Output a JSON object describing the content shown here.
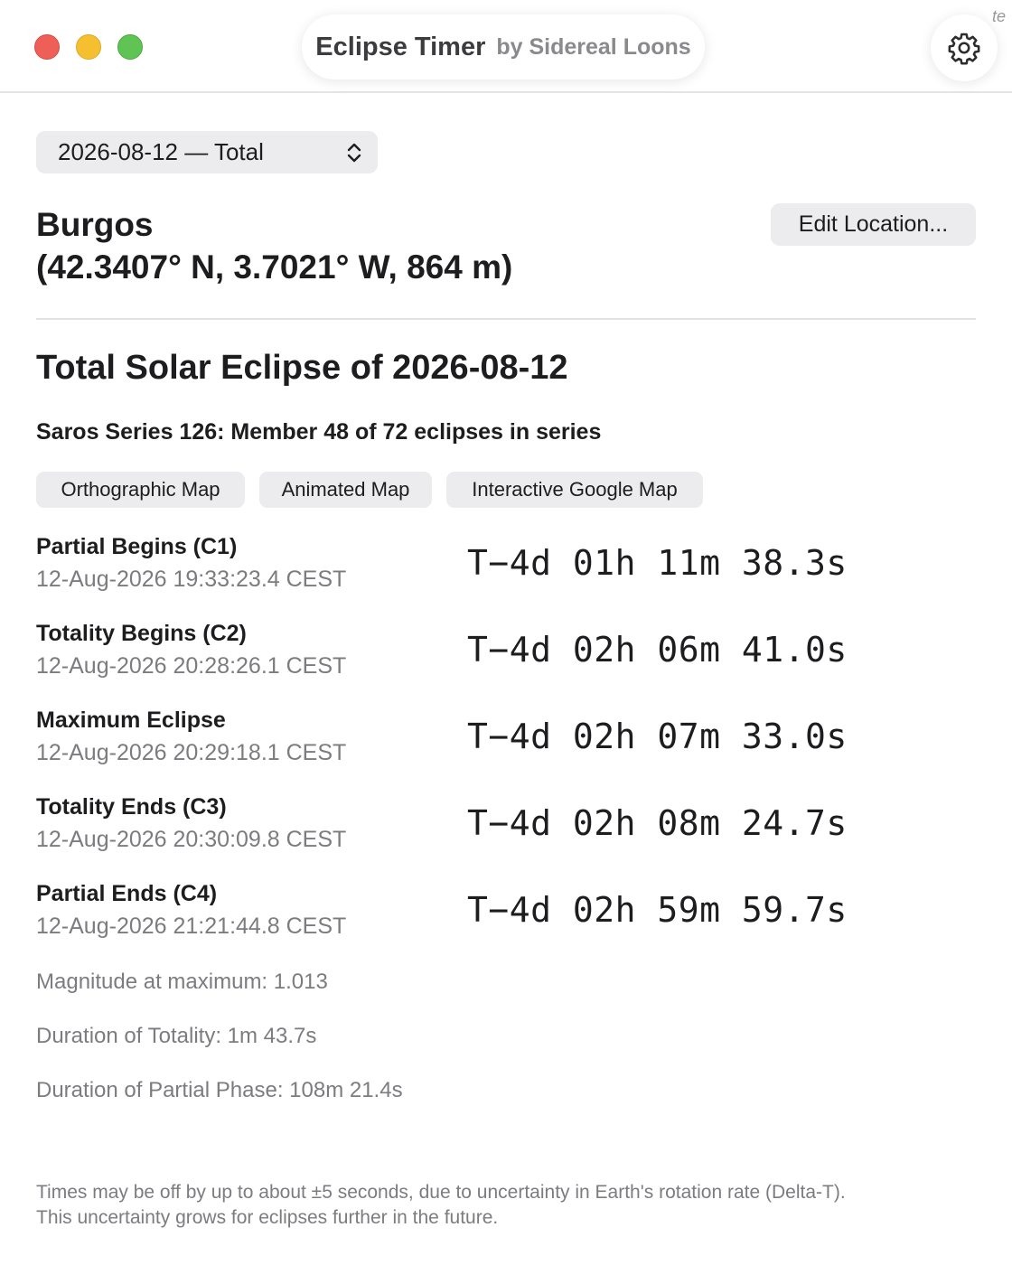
{
  "window": {
    "title": "Eclipse Timer",
    "subtitle": "by Sidereal Loons",
    "corner_fragment": "te"
  },
  "eclipse_selector": {
    "selected": "2026-08-12 — Total"
  },
  "location": {
    "name": "Burgos",
    "coords": "(42.3407° N, 3.7021° W, 864 m)",
    "edit_label": "Edit Location..."
  },
  "eclipse": {
    "title": "Total Solar Eclipse of 2026-08-12",
    "saros": "Saros Series 126: Member 48 of 72 eclipses in series"
  },
  "maps": {
    "orthographic": "Orthographic Map",
    "animated": "Animated Map",
    "google": "Interactive Google Map"
  },
  "events": [
    {
      "name": "Partial Begins (C1)",
      "time": "12-Aug-2026 19:33:23.4 CEST",
      "countdown": "T−4d 01h 11m 38.3s"
    },
    {
      "name": "Totality Begins (C2)",
      "time": "12-Aug-2026 20:28:26.1 CEST",
      "countdown": "T−4d 02h 06m 41.0s"
    },
    {
      "name": "Maximum Eclipse",
      "time": "12-Aug-2026 20:29:18.1 CEST",
      "countdown": "T−4d 02h 07m 33.0s"
    },
    {
      "name": "Totality Ends (C3)",
      "time": "12-Aug-2026 20:30:09.8 CEST",
      "countdown": "T−4d 02h 08m 24.7s"
    },
    {
      "name": "Partial Ends (C4)",
      "time": "12-Aug-2026 21:21:44.8 CEST",
      "countdown": "T−4d 02h 59m 59.7s"
    }
  ],
  "stats": {
    "magnitude": "Magnitude at maximum: 1.013",
    "totality_duration": "Duration of Totality: 1m 43.7s",
    "partial_duration": "Duration of Partial Phase: 108m 21.4s"
  },
  "footnote": {
    "line1": "Times may be off by up to about ±5 seconds, due to uncertainty in Earth's rotation rate (Delta-T).",
    "line2": "This uncertainty grows for eclipses further in the future."
  },
  "colors": {
    "close": "#ed5f57",
    "minimize": "#f5c02f",
    "maximize": "#5fc454",
    "secondary_text": "#7c7c80",
    "button_bg": "#ececee"
  },
  "icons": [
    "gear-icon",
    "chevron-updown-icon"
  ]
}
